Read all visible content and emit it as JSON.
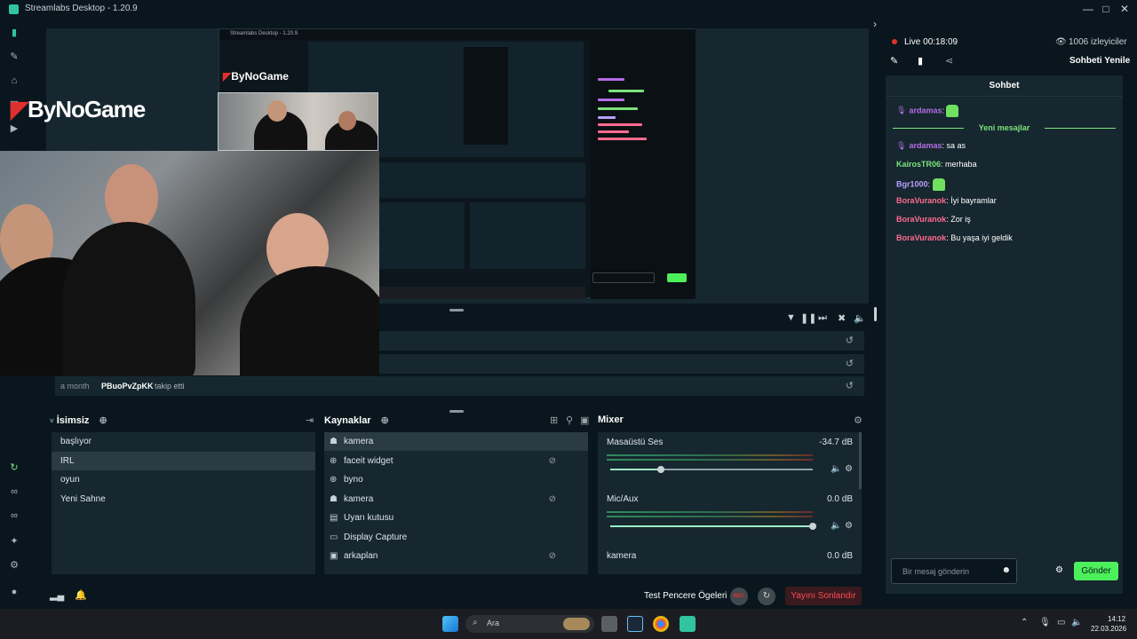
{
  "window": {
    "title": "Streamlabs Desktop - 1.20.9"
  },
  "nav_icons": [
    "editor-icon",
    "themes-icon",
    "store-icon",
    "layout-icon",
    "play-icon",
    "highlighter-icon",
    "link-icon",
    "link2-icon",
    "sparkle-icon",
    "settings-icon",
    "profile-icon"
  ],
  "preview": {
    "logo_text": "ByNoGame",
    "nested_title": "Streamlabs Desktop - 1.20.9",
    "nested_logo": "ByNoGame"
  },
  "events": {
    "time": "a month",
    "user": "PBuoPvZpKK",
    "action": "takip etti"
  },
  "scenes": {
    "title": "İsimsiz",
    "items": [
      "başlıyor",
      "IRL",
      "oyun",
      "Yeni Sahne"
    ],
    "selected_index": 1
  },
  "sources": {
    "title": "Kaynaklar",
    "items": [
      {
        "label": "kamera",
        "hidden": false,
        "icon": "camera-icon"
      },
      {
        "label": "faceit widget",
        "hidden": true,
        "icon": "globe-icon"
      },
      {
        "label": "byno",
        "hidden": false,
        "icon": "globe-icon"
      },
      {
        "label": "kamera",
        "hidden": true,
        "icon": "camera-icon"
      },
      {
        "label": "Uyarı kutusu",
        "hidden": false,
        "icon": "alert-icon"
      },
      {
        "label": "Display Capture",
        "hidden": false,
        "icon": "monitor-icon"
      },
      {
        "label": "arkaplan",
        "hidden": true,
        "icon": "image-icon"
      }
    ]
  },
  "mixer": {
    "title": "Mixer",
    "channels": [
      {
        "name": "Masaüstü Ses",
        "db": "-34.7 dB",
        "volume": 0.25
      },
      {
        "name": "Mic/Aux",
        "db": "0.0 dB",
        "volume": 1.0
      },
      {
        "name": "kamera",
        "db": "0.0 dB",
        "volume": 1.0
      }
    ]
  },
  "footer": {
    "test_label": "Test Pencere Ögeleri",
    "rec_label": "REC",
    "end_stream": "Yayını Sonlandır"
  },
  "status": {
    "live_label": "Live",
    "live_time": "00:18:09",
    "viewers": "1006 izleyiciler",
    "refresh_chat": "Sohbeti Yenile"
  },
  "chat": {
    "title": "Sohbet",
    "new_messages": "Yeni mesajlar",
    "messages": [
      {
        "user": "ardamas",
        "text": "",
        "emote": true,
        "color": "#b56de5"
      },
      {
        "user": "ardamas",
        "text": "sa as",
        "emote": false,
        "color": "#b56de5"
      },
      {
        "user": "KairosTR06",
        "text": "merhaba",
        "emote": false,
        "color": "#7be37b"
      },
      {
        "user": "Bgr1000",
        "text": "",
        "emote": true,
        "color": "#b9a0ff"
      },
      {
        "user": "BoraVuranok",
        "text": "İyi bayramlar",
        "emote": false,
        "color": "#ff6b8f"
      },
      {
        "user": "BoraVuranok",
        "text": "Zor iş",
        "emote": false,
        "color": "#ff6b8f"
      },
      {
        "user": "BoraVuranok",
        "text": "Bu yaşa iyi geldik",
        "emote": false,
        "color": "#ff6b8f"
      }
    ],
    "input_placeholder": "Bir mesaj gönderin",
    "send_label": "Gönder"
  },
  "taskbar": {
    "search_placeholder": "Ara",
    "time": "14:12",
    "date": "22.03.2026"
  },
  "colors": {
    "accent": "#31c3a2",
    "send": "#4cf05a",
    "danger": "#e0302e",
    "bg": "#09161d",
    "panel": "#16272f"
  }
}
